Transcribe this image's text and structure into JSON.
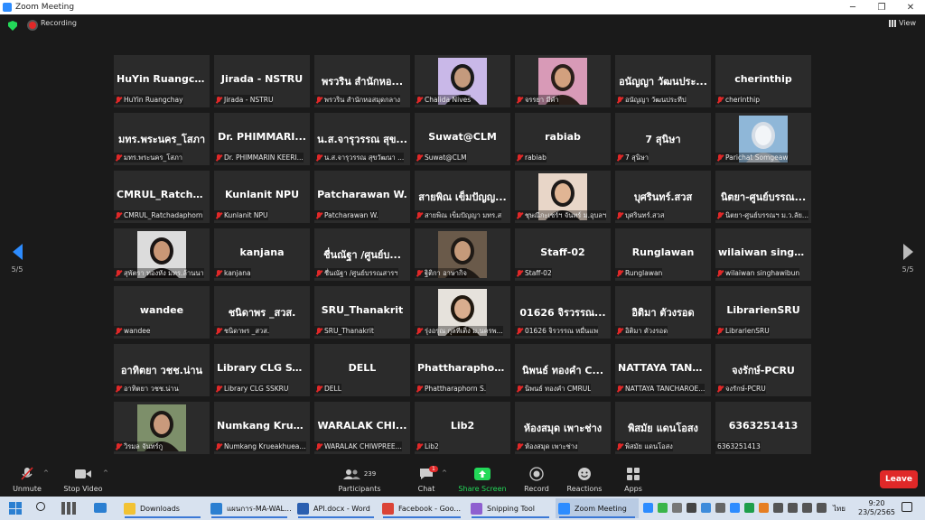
{
  "window": {
    "title": "Zoom Meeting"
  },
  "top_bar": {
    "recording_label": "Recording",
    "view_label": "View"
  },
  "nav": {
    "left_page": "5/5",
    "right_page": "5/5"
  },
  "participants": [
    {
      "big": "HuYin Ruangchay",
      "small": "HuYin Ruangchay",
      "video": false
    },
    {
      "big": "Jirada - NSTRU",
      "small": "Jirada - NSTRU",
      "video": false
    },
    {
      "big": "พรวริน สำนักหอ...",
      "small": "พรวริน สำนักหอสมุดกลาง",
      "video": false
    },
    {
      "big": "",
      "small": "Chalida Nives",
      "video": true,
      "bg": "#c9b8e8",
      "skin": "#c49a7d",
      "hair": "#1a1a1a"
    },
    {
      "big": "",
      "small": "จรรยา มีคำ",
      "video": true,
      "bg": "#d89ab7",
      "skin": "#d2a07e",
      "hair": "#2a1f1a"
    },
    {
      "big": "อนัญญา วัฒนประ...",
      "small": "อนัญญา วัฒนประทีป",
      "video": false
    },
    {
      "big": "cherinthip",
      "small": "cherinthip",
      "video": false
    },
    {
      "big": "มทร.พระนคร_โสภา",
      "small": "มทร.พระนคร_โสภา",
      "video": false
    },
    {
      "big": "Dr. PHIMMARI...",
      "small": "Dr. PHIMMARIN KEERI...",
      "video": false
    },
    {
      "big": "น.ส.จารุวรรณ สุข...",
      "small": "น.ส.จารุวรรณ สุขวัฒนา ...",
      "video": false
    },
    {
      "big": "Suwat@CLM",
      "small": "Suwat@CLM",
      "video": false
    },
    {
      "big": "rabiab",
      "small": "rabiab",
      "video": false
    },
    {
      "big": "7 สุนิษา",
      "small": "7 สุนิษา",
      "video": false
    },
    {
      "big": "",
      "small": "Parichat Somgeaw",
      "video": true,
      "bg": "#8fb7d8",
      "skin": "#f2f5f8",
      "hair": "#d5dde6"
    },
    {
      "big": "CMRUL_Ratcha...",
      "small": "CMRUL_Ratchadaphorn",
      "video": false
    },
    {
      "big": "Kunlanit NPU",
      "small": "Kunlanit NPU",
      "video": false
    },
    {
      "big": "Patcharawan W.",
      "small": "Patcharawan W.",
      "video": false
    },
    {
      "big": "สายพิณ เข็มปัญญ...",
      "small": "สายพิณ เข็มปัญญา มทร.ส",
      "video": false
    },
    {
      "big": "",
      "small": "ชุษณีกะเซร์ฯ จันทร์ ม.อุบลฯ",
      "video": true,
      "bg": "#e8d6c8",
      "skin": "#e0b594",
      "hair": "#1d1a19"
    },
    {
      "big": "บุศรินทร์.สวส",
      "small": "บุศรินทร์.สวส",
      "video": false
    },
    {
      "big": "นิตยา-ศูนย์บรรณ...",
      "small": "นิตยา-ศูนย์บรรณฯ ม.ว.ลัย...",
      "video": false
    },
    {
      "big": "",
      "small": "สุพัตรา ทองหัง มทร.ล้านนา",
      "video": true,
      "bg": "#dcdcdc",
      "skin": "#c99776",
      "hair": "#1a1514"
    },
    {
      "big": "kanjana",
      "small": "kanjana",
      "video": false
    },
    {
      "big": "ชื่นณัฐา /ศูนย์บ...",
      "small": "ชื่นณัฐา /ศูนย์บรรณสารฯ",
      "video": false
    },
    {
      "big": "",
      "small": "ฐิติกา อาษากิจ",
      "video": true,
      "bg": "#6a5a4a",
      "skin": "#c59a7a",
      "hair": "#1f1a16"
    },
    {
      "big": "Staff-02",
      "small": "Staff-02",
      "video": false
    },
    {
      "big": "Runglawan",
      "small": "Runglawan",
      "video": false
    },
    {
      "big": "wilaiwan singha...",
      "small": "wilaiwan singhawibun",
      "video": false
    },
    {
      "big": "wandee",
      "small": "wandee",
      "video": false
    },
    {
      "big": "ชนิดาพร _สวส.",
      "small": "ชนิดาพร _สวส.",
      "video": false
    },
    {
      "big": "SRU_Thanakrit",
      "small": "SRU_Thanakrit",
      "video": false
    },
    {
      "big": "",
      "small": "รุ่งอรุณ กุลทีเติ่ง ม.นครพ...",
      "video": true,
      "bg": "#e6e2dc",
      "skin": "#d9ad8e",
      "hair": "#20180f"
    },
    {
      "big": "01626 จิรวรรณ...",
      "small": "01626 จิรวรรณ หมื่นแพ",
      "video": false
    },
    {
      "big": "อิติมา ตัวงรอด",
      "small": "อิติมา ตัวงรอด",
      "video": false
    },
    {
      "big": "LibrarienSRU",
      "small": "LibrarienSRU",
      "video": false
    },
    {
      "big": "อาทิตยา วชช.น่าน",
      "small": "อาทิตยา วชช.น่าน",
      "video": false
    },
    {
      "big": "Library CLG SSK...",
      "small": "Library CLG SSKRU",
      "video": false
    },
    {
      "big": "DELL",
      "small": "DELL",
      "video": false
    },
    {
      "big": "Phattharaphorn...",
      "small": "Phattharaphorn S.",
      "video": false
    },
    {
      "big": "นิพนธ์ ทองคำ C...",
      "small": "นิพนธ์ ทองคำ CMRUL",
      "video": false
    },
    {
      "big": "NATTAYA TANC...",
      "small": "NATTAYA TANCHAROE...",
      "video": false
    },
    {
      "big": "จงรักษ์-PCRU",
      "small": "จงรักษ์-PCRU",
      "video": false
    },
    {
      "big": "",
      "small": "วิรมล จันทร์กู",
      "video": true,
      "bg": "#7d8f6a",
      "skin": "#c99a7c",
      "hair": "#1c1815"
    },
    {
      "big": "Numkang Krue...",
      "small": "Numkang Krueakhuea...",
      "video": false
    },
    {
      "big": "WARALAK CHI...",
      "small": "WARALAK CHIWPREE...",
      "video": false
    },
    {
      "big": "Lib2",
      "small": "Lib2",
      "video": false
    },
    {
      "big": "ห้องสมุด เพาะช่าง",
      "small": "ห้องสมุด เพาะช่าง",
      "video": false
    },
    {
      "big": "พิสมัย แดนโอสง",
      "small": "พิสมัย แดนโอสง",
      "video": false
    },
    {
      "big": "6363251413",
      "small": "6363251413",
      "video": false,
      "unmuted": true
    }
  ],
  "toolbar": {
    "unmute": "Unmute",
    "stop_video": "Stop Video",
    "participants": "Participants",
    "participants_count": "239",
    "chat": "Chat",
    "chat_badge": "1",
    "share_screen": "Share Screen",
    "record": "Record",
    "reactions": "Reactions",
    "apps": "Apps",
    "leave": "Leave",
    "colors": {
      "share": "#23d959",
      "leave": "#e02828"
    }
  },
  "taskbar": {
    "apps": [
      {
        "label": "Downloads",
        "color": "#f2c233"
      },
      {
        "label": "แผนการ-MA-WAL...",
        "color": "#2b7fd1"
      },
      {
        "label": "API.docx - Word",
        "color": "#2b5fb0"
      },
      {
        "label": "Facebook - Goo...",
        "color": "#db4437"
      },
      {
        "label": "Snipping Tool",
        "color": "#8e5fd0"
      },
      {
        "label": "Zoom Meeting",
        "color": "#2d8cff"
      }
    ],
    "language": "ไทย",
    "time": "9:20",
    "date": "23/5/2565"
  }
}
